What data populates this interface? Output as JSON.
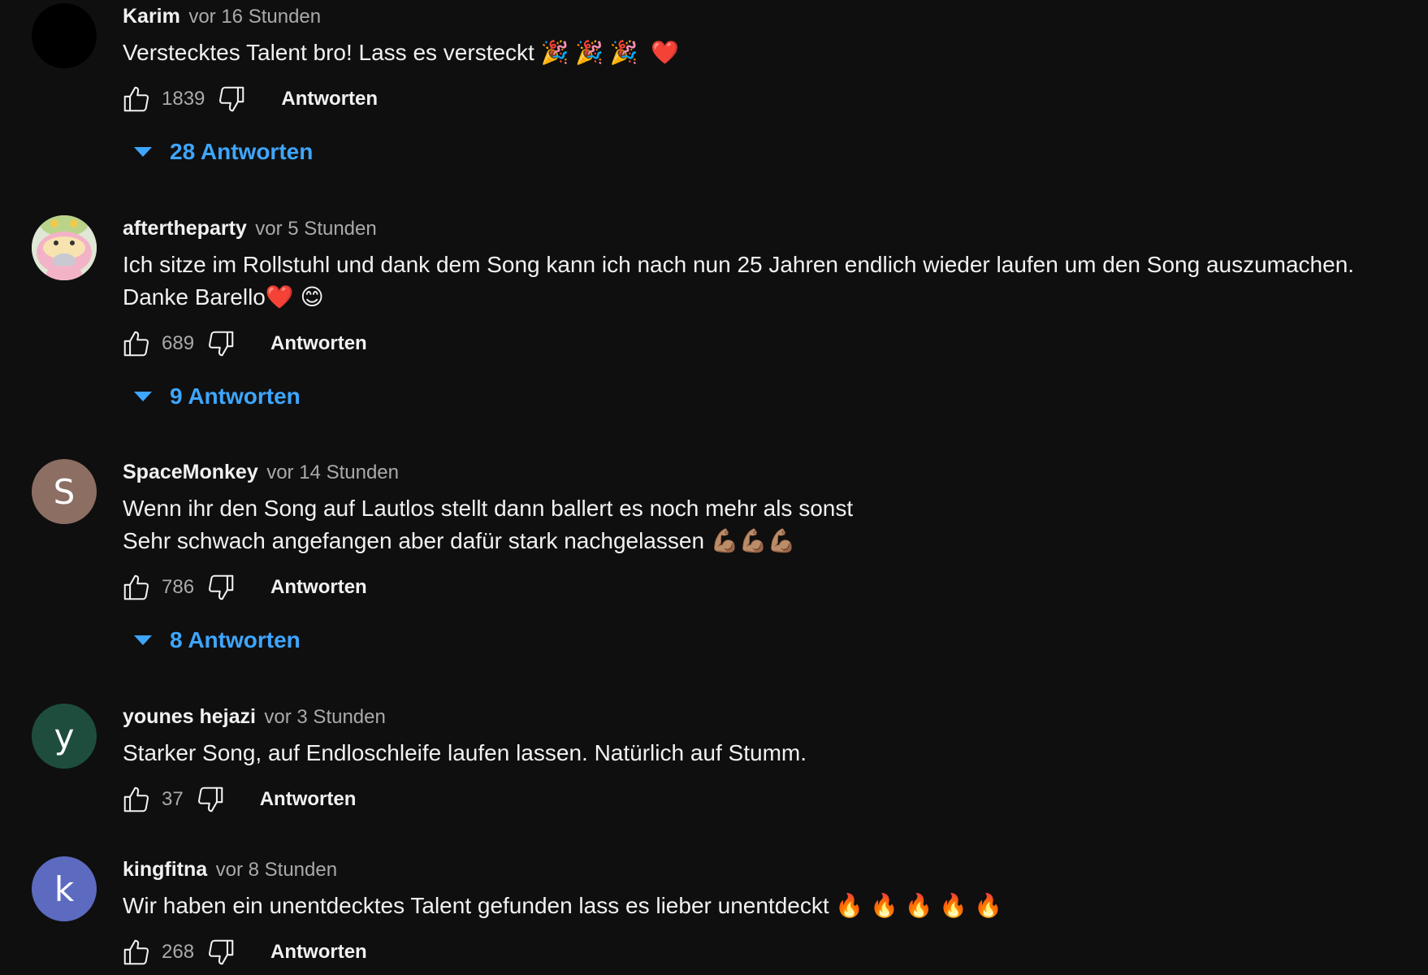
{
  "colors": {
    "background": "#0f0f0f",
    "text": "#f1f1f1",
    "secondary": "#aaaaaa",
    "link": "#3ea6ff"
  },
  "comments": [
    {
      "author": "Karim",
      "time": "vor 16 Stunden",
      "text": "Versteckte s Talent bro! Lass es versteckt 🎉 🎉 🎉  ❤️",
      "likes": "1839",
      "reply_label": "Antworten",
      "replies_label": "28 Antworten",
      "avatar": {
        "type": "solid",
        "color": "#000000",
        "letter": ""
      }
    },
    {
      "author": "aftertheparty",
      "time": "vor 5 Stunden",
      "text": "Ich sitze im Rollstuhl und dank dem Song kann ich nach nun 25 Jahren endlich wieder laufen um den Song auszumachen. Danke Barello❤️ 😊",
      "likes": "689",
      "reply_label": "Antworten",
      "replies_label": "9 Antworten",
      "avatar": {
        "type": "image",
        "icon": "pokemon-avatar-icon"
      }
    },
    {
      "author": "SpaceMonkey",
      "time": "vor 14 Stunden",
      "text": "Wenn ihr den Song auf Lautlos stellt dann ballert es noch mehr als sonst\nSehr schwach angefangen aber dafür stark nachgelassen 💪🏽💪🏽💪🏽",
      "likes": "786",
      "reply_label": "Antworten",
      "replies_label": "8 Antworten",
      "avatar": {
        "type": "letter",
        "color": "#8d6e63",
        "letter": "S"
      }
    },
    {
      "author": "younes hejazi",
      "time": "vor 3 Stunden",
      "text": "Starker Song, auf Endloschleife laufen lassen. Natürlich auf Stumm.",
      "likes": "37",
      "reply_label": "Antworten",
      "replies_label": "",
      "avatar": {
        "type": "letter",
        "color": "#1e4d3e",
        "letter": "y"
      }
    },
    {
      "author": "kingfitna",
      "time": "vor 8 Stunden",
      "text": "Wir haben ein unentdecktes Talent gefunden lass es lieber unentdeckt 🔥 🔥 🔥 🔥 🔥",
      "likes": "268",
      "reply_label": "Antworten",
      "replies_label": "",
      "avatar": {
        "type": "letter",
        "color": "#5c6bc0",
        "letter": "k"
      }
    }
  ]
}
